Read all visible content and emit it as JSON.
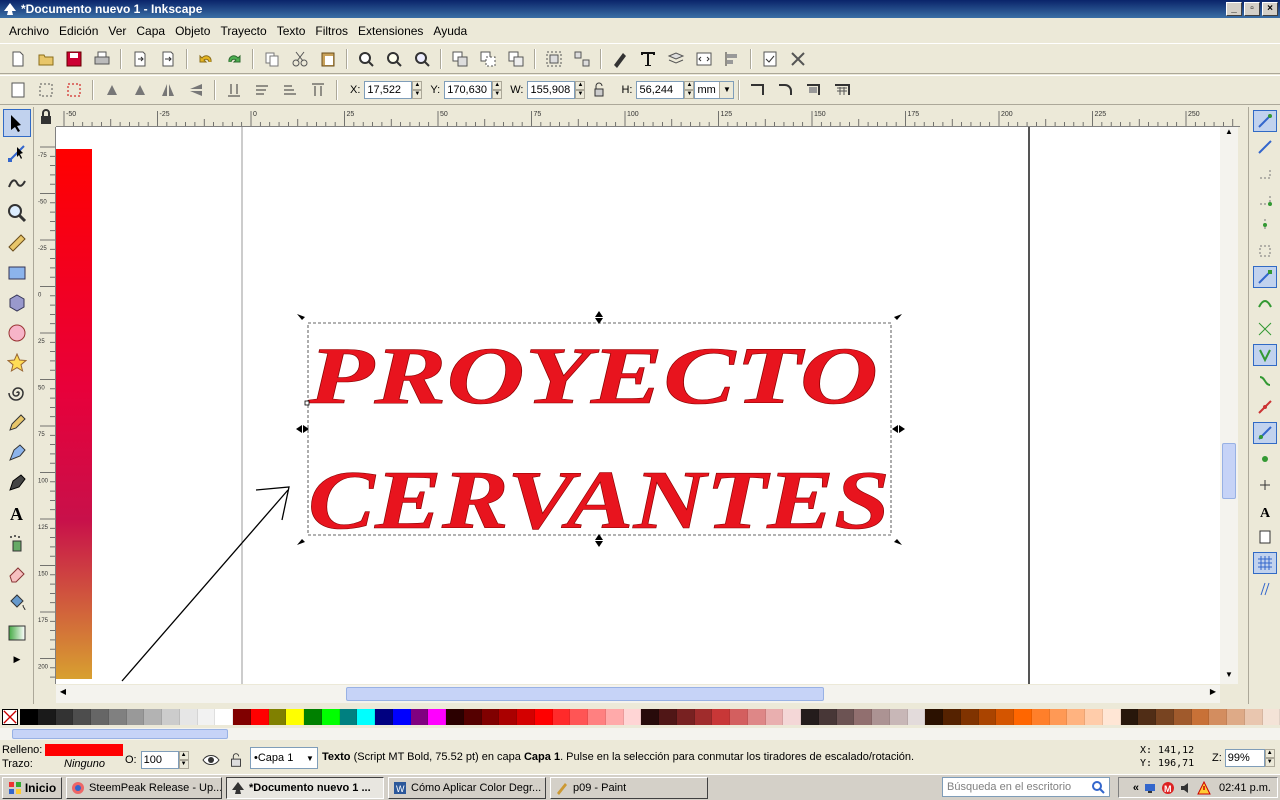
{
  "window": {
    "title": "*Documento nuevo 1 - Inkscape"
  },
  "menu": [
    {
      "u": "A",
      "rest": "rchivo"
    },
    {
      "u": "E",
      "rest": "dición"
    },
    {
      "u": "V",
      "rest": "er"
    },
    {
      "u": "C",
      "rest": "apa"
    },
    {
      "u": "O",
      "rest": "bjeto"
    },
    {
      "u": "T",
      "rest": "rayecto"
    },
    {
      "u": "T",
      "rest": "exto"
    },
    {
      "u": "",
      "rest": "Filtros"
    },
    {
      "u": "",
      "rest": "Extensiones"
    },
    {
      "u": "",
      "rest": "Ayuda"
    }
  ],
  "menu_labels": [
    "Archivo",
    "Edición",
    "Ver",
    "Capa",
    "Objeto",
    "Trayecto",
    "Texto",
    "Filtros",
    "Extensiones",
    "Ayuda"
  ],
  "toolctrl": {
    "x_label": "X:",
    "x_value": "17,522",
    "y_label": "Y:",
    "y_value": "170,630",
    "w_label": "W:",
    "w_value": "155,908",
    "h_label": "H:",
    "h_value": "56,244",
    "unit": "mm"
  },
  "ruler": {
    "h_labels": [
      "-50",
      "-25",
      "0",
      "25",
      "50",
      "75",
      "100",
      "125",
      "150",
      "175",
      "200",
      "225",
      "250"
    ],
    "v_labels": [
      "-75",
      "-50",
      "-25",
      "0",
      "25",
      "50",
      "75",
      "100",
      "125",
      "150",
      "175",
      "200",
      "225",
      "250"
    ]
  },
  "canvas": {
    "line1": "PROYECTO",
    "line2": "CERVANTES",
    "text_color": "#e8141e"
  },
  "status": {
    "fill_label": "Relleno:",
    "stroke_label": "Trazo:",
    "stroke_value": "Ninguno",
    "fill_color": "#ff0000",
    "opacity_label": "O:",
    "opacity_value": "100",
    "layer": "•Capa 1",
    "msg_bold": "Texto",
    "msg_a": " (Script MT Bold, 75.52 pt) en capa ",
    "msg_layer": "Capa 1",
    "msg_b": ". Pulse en la selección para conmutar los tiradores de escalado/rotación.",
    "coord_x": "X:  141,12",
    "coord_y": "Y:  196,71",
    "zoom_label": "Z:",
    "zoom_value": "99%"
  },
  "taskbar": {
    "start": "Inicio",
    "tasks": [
      "SteemPeak Release - Up...",
      "*Documento nuevo 1 ...",
      "Cómo Aplicar Color Degr...",
      "p09 - Paint"
    ],
    "search_placeholder": "Búsqueda en el escritorio",
    "clock": "02:41 p.m."
  },
  "palette_colors": [
    "#000000",
    "#1a1a1a",
    "#333333",
    "#4d4d4d",
    "#666666",
    "#808080",
    "#999999",
    "#b3b3b3",
    "#cccccc",
    "#e6e6e6",
    "#f2f2f2",
    "#ffffff",
    "#800000",
    "#ff0000",
    "#808000",
    "#ffff00",
    "#008000",
    "#00ff00",
    "#008080",
    "#00ffff",
    "#000080",
    "#0000ff",
    "#800080",
    "#ff00ff",
    "#2b0000",
    "#550000",
    "#800000",
    "#aa0000",
    "#d40000",
    "#ff0000",
    "#ff2a2a",
    "#ff5555",
    "#ff8080",
    "#ffaaaa",
    "#ffd5d5",
    "#280b0b",
    "#501616",
    "#782121",
    "#a02c2c",
    "#c83737",
    "#d35f5f",
    "#de8787",
    "#e9afaf",
    "#f4d7d7",
    "#241c1c",
    "#483737",
    "#6c5353",
    "#916f6f",
    "#ac9393",
    "#c8b7b7",
    "#e3dbdb",
    "#2b1100",
    "#552200",
    "#803300",
    "#aa4400",
    "#d45500",
    "#ff6600",
    "#ff7f2a",
    "#ff9955",
    "#ffb380",
    "#ffccaa",
    "#ffe6d5",
    "#28170b",
    "#502d16",
    "#784421",
    "#a05a2c",
    "#c87137",
    "#d38d5f",
    "#deaa87",
    "#e9c6af",
    "#f4e3d7"
  ]
}
